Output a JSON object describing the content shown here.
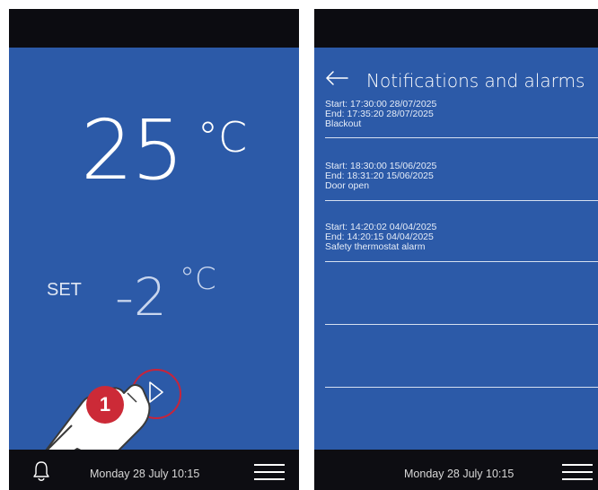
{
  "main_screen": {
    "current_temp": "25",
    "current_unit": "°C",
    "set_label": "SET",
    "set_value": "-2",
    "set_unit": "°C",
    "play_icon": "play-icon",
    "callout_number": "1",
    "bell_icon": "bell-icon",
    "date": "Monday 28 July 10:15",
    "menu_icon": "hamburger-menu-icon"
  },
  "notifications_screen": {
    "title": "Notifications and alarms",
    "back_icon": "back-arrow-icon",
    "items": [
      {
        "start": "Start: 17:30:00  28/07/2025",
        "end": "End: 17:35:20  28/07/2025",
        "type": "Blackout"
      },
      {
        "start": "Start: 18:30:00  15/06/2025",
        "end": "End: 18:31:20  15/06/2025",
        "type": "Door open"
      },
      {
        "start": "Start: 14:20:02  04/04/2025",
        "end": "End: 14:20:15  04/04/2025",
        "type": "Safety thermostat alarm"
      }
    ],
    "date": "Monday 28 July 10:15",
    "menu_icon": "hamburger-menu-icon"
  },
  "colors": {
    "screen_blue": "#2c5aa8",
    "bar_dark": "#0d0d12",
    "accent_red": "#cc2a37",
    "text_white": "#ffffff"
  }
}
